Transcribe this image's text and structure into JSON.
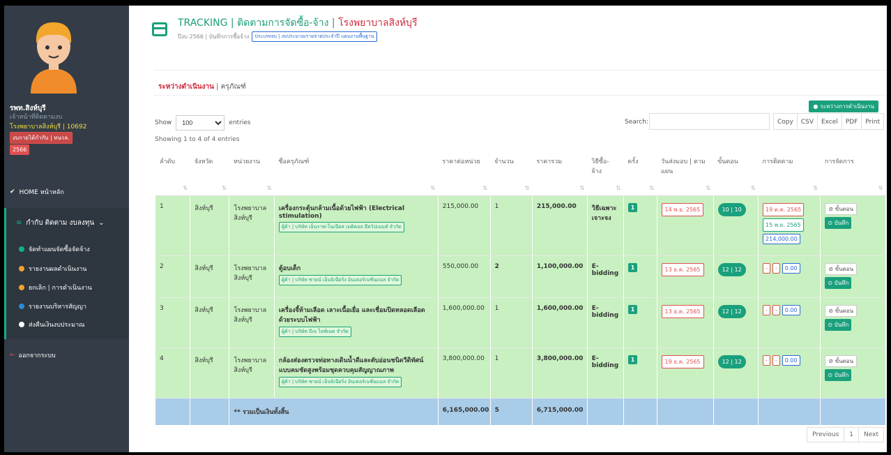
{
  "sidebar": {
    "user_name": "รพท.สิงห์บุรี",
    "role": "เจ้าหน้าที่ติดตามงบ",
    "org": "โรงพยาบาลสิงห์บุรี | 10692",
    "badge": "งบกายได้กำกับ | ทนรล.",
    "year": "2566",
    "home": "HOME หน้าหลัก",
    "main_menu": "กำกับ ติดตาม งบลงทุน",
    "items": [
      {
        "label": "จัดทำแผนจัดซื้อจัดจ้าง",
        "color": "#10b08a"
      },
      {
        "label": "รายงานผลดำเนินงาน",
        "color": "#f0a030"
      },
      {
        "label": "ยกเลิก | การดำเนินงาน",
        "color": "#f0a030"
      },
      {
        "label": "รายงานบริหารสัญญา",
        "color": "#2a8ad6"
      },
      {
        "label": "ส่งคืนเงินงบประมาณ",
        "color": "#ffffff"
      }
    ],
    "logout": "ออกจากระบบ"
  },
  "header": {
    "title_prefix": "TRACKING | ติดตามการจัดซื้อ-จ้าง | ",
    "title_org": "โรงพยาบาลสิงห์บุรี",
    "subtitle": "ปีงบ 2566 | บันทึกการซื้อจ้าง",
    "tag": "ประเภทงบ | งบประมาณรายจ่ายประจำปี แผนงานพื้นฐาน"
  },
  "section": {
    "title_red": "ระหว่างดำเนินงาน",
    "title_rest": " | ครุภัณฑ์",
    "button": "ระหว่างการดำเนินงาน"
  },
  "controls": {
    "show": "Show",
    "entries_value": "100",
    "entries": "entries",
    "search": "Search:",
    "exports": [
      "Copy",
      "CSV",
      "Excel",
      "PDF",
      "Print"
    ],
    "showing": "Showing 1 to 4 of 4 entries"
  },
  "table": {
    "headers": [
      "ลำดับ",
      "จังหวัด",
      "หน่วยงาน",
      "ชื่อครุภัณฑ์",
      "ราคาต่อหน่วย",
      "จำนวน",
      "ราคารวม",
      "วิธีซื้อ-จ้าง",
      "ครั้ง",
      "วันส่งมอบ | ตามแผน",
      "ขั้นตอน",
      "การติดตาม",
      "การจัดการ"
    ],
    "rows": [
      {
        "no": "1",
        "province": "สิงห์บุรี",
        "unit": "โรงพยาบาลสิงห์บุรี",
        "item": "เครื่องกระตุ้นกล้ามเนื้อด้วยไฟฟ้า (Electrical stimulation)",
        "supplier": "ผู้ค้า | บริษัท เอ็นราฟ-โนเนียส เมดิคอล อีควิปเมนท์ จำกัด",
        "price": "215,000.00",
        "qty": "1",
        "total": "215,000.00",
        "method": "วิธีเฉพาะเจาะจง",
        "round": "1",
        "delivery": "14 พ.ย. 2565",
        "step": "10 | 10",
        "track1": "19 ต.ค. 2565",
        "track2": "15 พ.ย. 2565",
        "track3": "214,000.00",
        "status": "ขั้นตอน",
        "save": "บันทึก"
      },
      {
        "no": "2",
        "province": "สิงห์บุรี",
        "unit": "โรงพยาบาลสิงห์บุรี",
        "item": "ตู้อบเด็ก",
        "supplier": "ผู้ค้า | บริษัท ซายน์ เอ็นจิเนียริ่ง อินเตอร์เนชั่นแนล จำกัด",
        "price": "550,000.00",
        "qty": "2",
        "total": "1,100,000.00",
        "method": "E-bidding",
        "round": "1",
        "delivery": "13 ธ.ค. 2565",
        "step": "12 | 12",
        "track1": "-",
        "track2": "-",
        "track3": "0.00",
        "status": "ขั้นตอน",
        "save": "บันทึก"
      },
      {
        "no": "3",
        "province": "สิงห์บุรี",
        "unit": "โรงพยาบาลสิงห์บุรี",
        "item": "เครื่องจี้ห้ามเลือด เลาะเนื้อเยื่อ และเชื่อมปิดหลอดเลือดด้วยระบบไฟฟ้า",
        "supplier": "ผู้ค้า | บริษัท บีเจ ไลฟ์เมด จำกัด",
        "price": "1,600,000.00",
        "qty": "1",
        "total": "1,600,000.00",
        "method": "E-bidding",
        "round": "1",
        "delivery": "13 ธ.ค. 2565",
        "step": "12 | 12",
        "track1": "-",
        "track2": "-",
        "track3": "0.00",
        "status": "ขั้นตอน",
        "save": "บันทึก"
      },
      {
        "no": "4",
        "province": "สิงห์บุรี",
        "unit": "โรงพยาบาลสิงห์บุรี",
        "item": "กล้องส่องตรวจท่อทางเดินน้ำดีและตับอ่อนชนิดวีดิทัศน์แบบคมชัดสูงพร้อมชุดควบคุมสัญญาณภาพ",
        "supplier": "ผู้ค้า | บริษัท ซายน์ เอ็นจิเนียริ่ง อินเตอร์เนชั่นแนล จำกัด",
        "price": "3,800,000.00",
        "qty": "1",
        "total": "3,800,000.00",
        "method": "E-bidding",
        "round": "1",
        "delivery": "19 ธ.ค. 2565",
        "step": "12 | 12",
        "track1": "-",
        "track2": "-",
        "track3": "0.00",
        "status": "ขั้นตอน",
        "save": "บันทึก"
      }
    ],
    "total": {
      "label": "** รวมเป็นเงินทั้งสิ้น",
      "price": "6,165,000.00",
      "qty": "5",
      "total": "6,715,000.00"
    }
  },
  "pager": {
    "prev": "Previous",
    "page": "1",
    "next": "Next"
  }
}
